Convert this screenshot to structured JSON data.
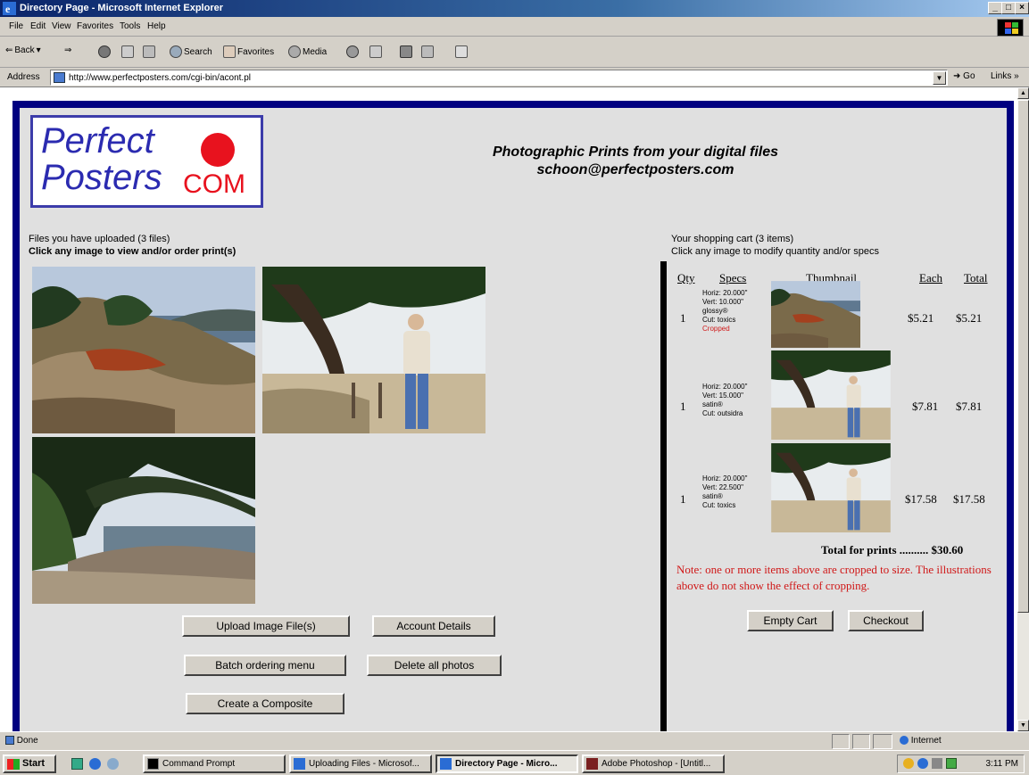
{
  "window": {
    "title": "Directory Page - Microsoft Internet Explorer",
    "controls": [
      "_",
      "□",
      "×"
    ]
  },
  "menu": [
    "File",
    "Edit",
    "View",
    "Favorites",
    "Tools",
    "Help"
  ],
  "toolbar": {
    "back": "Back",
    "search": "Search",
    "favorites": "Favorites",
    "media": "Media"
  },
  "address": {
    "label": "Address",
    "url": "http://www.perfectposters.com/cgi-bin/acont.pl",
    "go": "Go",
    "links": "Links »"
  },
  "page": {
    "logo": {
      "line1": "Perfect",
      "line2": "Posters",
      "com": "COM"
    },
    "tagline": "Photographic Prints from your digital files",
    "email": "schoon@perfectposters.com",
    "uploaded": {
      "title": "Files you have uploaded (3 files)",
      "hint": "Click any image to view and/or order print(s)"
    },
    "buttons": {
      "upload": "Upload Image File(s)",
      "account": "Account Details",
      "batch": "Batch ordering menu",
      "delete_all": "Delete all photos",
      "composite": "Create a Composite"
    },
    "cart": {
      "title": "Your shopping cart (3 items)",
      "hint": "Click any image to modify quantity and/or specs",
      "headers": {
        "qty": "Qty",
        "specs": "Specs",
        "thumbnail": "Thumbnail",
        "each": "Each",
        "total": "Total"
      },
      "items": [
        {
          "qty": "1",
          "horiz": "Horiz: 20.000\"",
          "vert": "Vert: 10.000\"",
          "finish": "glossy®",
          "cut": "Cut: toxics",
          "status": "Cropped",
          "each": "$5.21",
          "total": "$5.21"
        },
        {
          "qty": "1",
          "horiz": "Horiz: 20.000\"",
          "vert": "Vert: 15.000\"",
          "finish": "satin®",
          "cut": "Cut: outsidra",
          "status": "",
          "each": "$7.81",
          "total": "$7.81"
        },
        {
          "qty": "1",
          "horiz": "Horiz: 20.000\"",
          "vert": "Vert: 22.500\"",
          "finish": "satin®",
          "cut": "Cut: toxics",
          "status": "",
          "each": "$17.58",
          "total": "$17.58"
        }
      ],
      "total_label": "Total for prints .......... $30.60",
      "note": "Note: one or more items above are cropped to size. The illustrations above do not show the effect of cropping.",
      "empty_button": "Empty Cart",
      "checkout_button": "Checkout"
    }
  },
  "statusbar": {
    "status": "Done",
    "zone": "Internet"
  },
  "taskbar": {
    "start": "Start",
    "tasks": [
      "Command Prompt",
      "Uploading Files - Microsof...",
      "Directory Page - Micro...",
      "Adobe Photoshop - [Untitl..."
    ],
    "clock": "3:11 PM"
  },
  "colors": {
    "frame": "#000080",
    "brand_blue": "#2b2bb0",
    "brand_red": "#e8121e",
    "note_red": "#d01818"
  }
}
